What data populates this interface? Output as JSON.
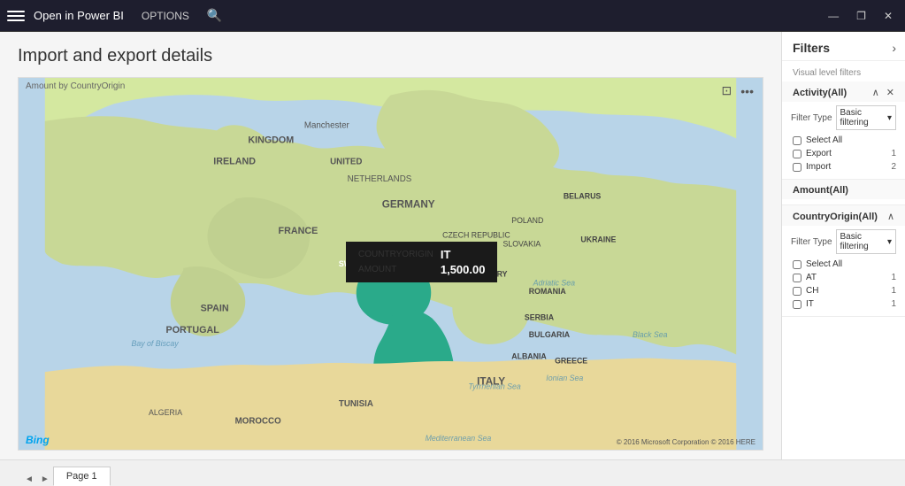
{
  "titleBar": {
    "appName": "Open in Power BI",
    "options": "OPTIONS",
    "searchIcon": "🔍",
    "windowControls": {
      "minimize": "—",
      "restore": "❐",
      "close": "✕"
    }
  },
  "report": {
    "title": "Import and export details",
    "visualLabel": "Amount by CountryOrigin",
    "tooltip": {
      "row1Label": "COUNTRYORIGIN",
      "row1Value": "IT",
      "row2Label": "AMOUNT",
      "row2Value": "1,500.00"
    },
    "bingLogo": "Bing",
    "copyright": "© 2016 Microsoft Corporation   © 2016 HERE"
  },
  "pageTabs": {
    "prevArrow": "◄",
    "nextArrow": "►",
    "tabs": [
      {
        "label": "Page 1",
        "active": true
      }
    ]
  },
  "filters": {
    "header": "Filters",
    "collapseIcon": "›",
    "visualLevelLabel": "Visual level filters",
    "sections": [
      {
        "id": "activity",
        "title": "Activity(All)",
        "controls": [
          "∧",
          "✕"
        ],
        "filterTypeLabel": "Filter Type",
        "filterTypeValue": "Basic filtering",
        "items": [
          {
            "label": "Select All",
            "count": "",
            "checked": false
          },
          {
            "label": "Export",
            "count": "1",
            "checked": false
          },
          {
            "label": "Import",
            "count": "2",
            "checked": false
          }
        ]
      }
    ],
    "amountSection": {
      "title": "Amount(All)"
    },
    "countryOriginSection": {
      "id": "countryOrigin",
      "title": "CountryOrigin(All)",
      "controls": [
        "∧"
      ],
      "filterTypeLabel": "Filter Type",
      "filterTypeValue": "Basic filtering",
      "items": [
        {
          "label": "Select All",
          "count": "",
          "checked": false
        },
        {
          "label": "AT",
          "count": "1",
          "checked": false
        },
        {
          "label": "CH",
          "count": "1",
          "checked": false
        },
        {
          "label": "IT",
          "count": "1",
          "checked": false
        }
      ]
    }
  }
}
